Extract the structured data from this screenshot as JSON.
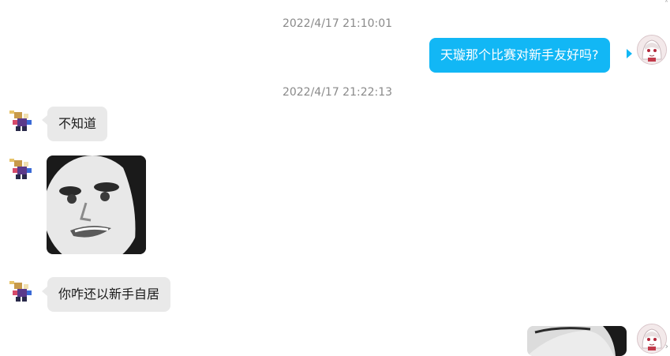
{
  "messages": {
    "timestamp_1": "2022/4/17 21:10:01",
    "out_1": "天璇那个比赛对新手友好吗?",
    "timestamp_2": "2022/4/17 21:22:13",
    "in_1": "不知道",
    "in_3": "你咋还以新手自居"
  },
  "icons": {
    "other_avatar": "pixel-character-avatar-icon",
    "self_avatar": "anime-girl-avatar-icon",
    "sticker": "meme-face-sticker"
  },
  "colors": {
    "outgoing_bubble": "#12b7f5",
    "incoming_bubble": "#e9e9e9",
    "timestamp_text": "#8a8a8a"
  }
}
